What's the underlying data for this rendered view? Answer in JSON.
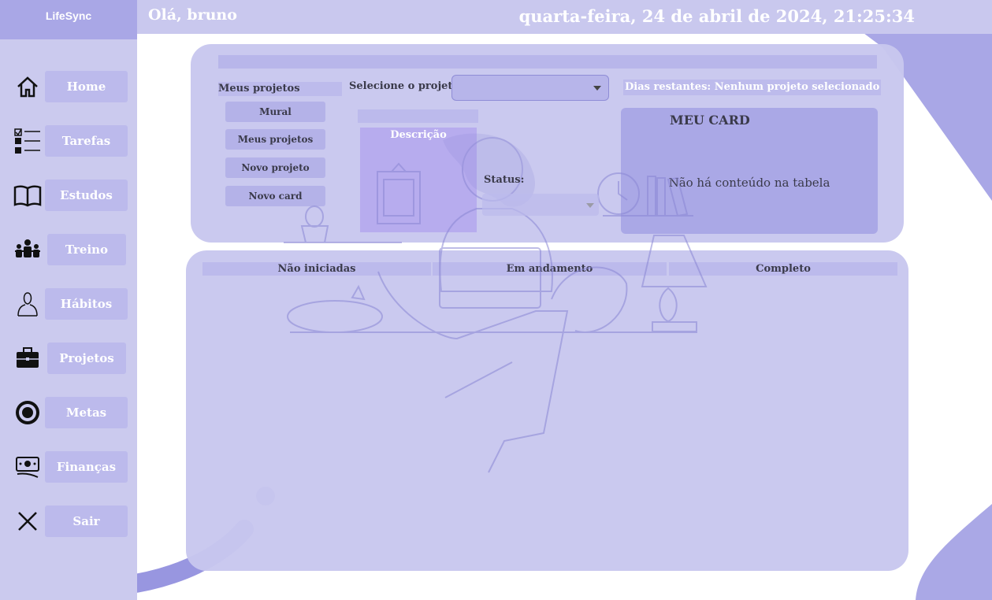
{
  "brand": "LifeSync",
  "header": {
    "greeting": "Olá, bruno",
    "datetime": "quarta-feira, 24 de abril de 2024, 21:25:34"
  },
  "sidebar": {
    "items": [
      {
        "label": "Home",
        "icon": "home-icon"
      },
      {
        "label": "Tarefas",
        "icon": "checklist-icon"
      },
      {
        "label": "Estudos",
        "icon": "book-icon"
      },
      {
        "label": "Treino",
        "icon": "team-icon"
      },
      {
        "label": "Hábitos",
        "icon": "user-icon"
      },
      {
        "label": "Projetos",
        "icon": "briefcase-icon"
      },
      {
        "label": "Metas",
        "icon": "target-icon"
      },
      {
        "label": "Finanças",
        "icon": "money-icon"
      },
      {
        "label": "Sair",
        "icon": "close-icon"
      }
    ]
  },
  "projects": {
    "my_projects_label": "Meus projetos",
    "buttons": [
      "Mural",
      "Meus projetos",
      "Novo projeto",
      "Novo card"
    ],
    "select_label": "Selecione o projeto:",
    "select_value": "",
    "days_remaining": "Dias restantes: Nenhum projeto selecionado",
    "description_title": "Descrição",
    "status_label": "Status:",
    "card_title": "MEU CARD",
    "card_empty": "Não há conteúdo na tabela"
  },
  "kanban": {
    "columns": [
      "Não iniciadas",
      "Em andamento",
      "Completo"
    ]
  },
  "colors": {
    "accent": "#a9a7e6",
    "panel": "#c8c7ee",
    "sidebar": "#cbcaee"
  }
}
